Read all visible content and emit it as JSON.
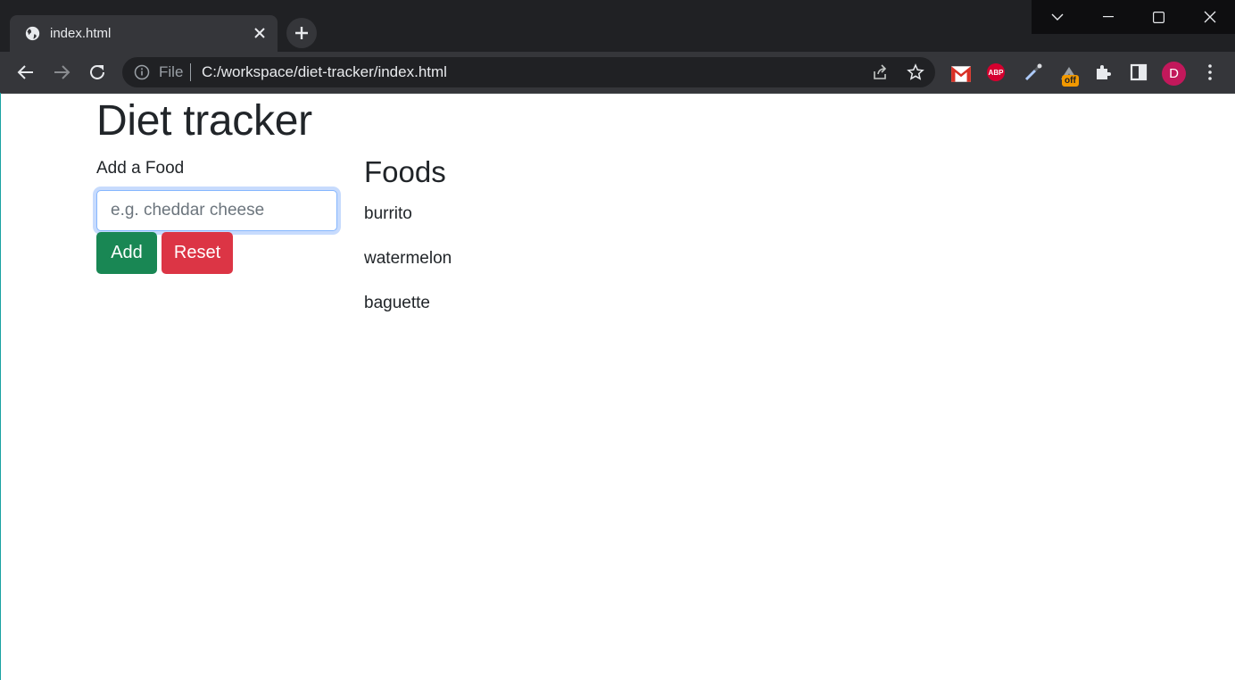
{
  "browser": {
    "tab_title": "index.html",
    "scheme_label": "File",
    "url": "C:/workspace/diet-tracker/index.html",
    "extension_badge": "off",
    "avatar_letter": "D"
  },
  "page": {
    "title": "Diet tracker",
    "form_label": "Add a Food",
    "input_placeholder": "e.g. cheddar cheese",
    "input_value": "",
    "add_label": "Add",
    "reset_label": "Reset",
    "foods_heading": "Foods",
    "foods": [
      "burrito",
      "watermelon",
      "baguette"
    ]
  },
  "colors": {
    "add_button": "#198754",
    "reset_button": "#dc3545",
    "text": "#212529",
    "focus_ring": "#c7dbfd"
  }
}
